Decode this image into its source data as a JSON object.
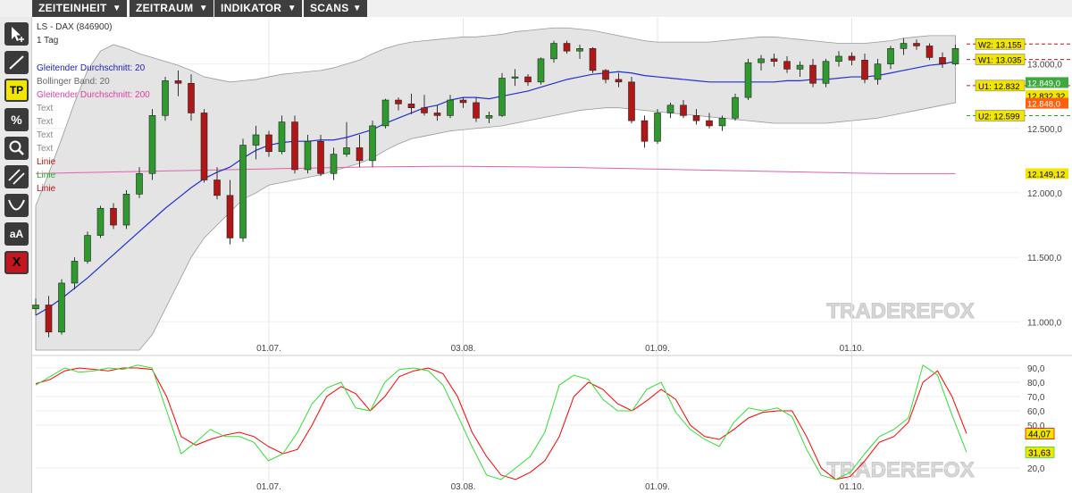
{
  "menus": [
    "ZEITEINHEIT",
    "ZEITRAUM",
    "INDIKATOR",
    "SCANS"
  ],
  "menu_arrow": "▼",
  "tools": [
    {
      "name": "cursor-icon"
    },
    {
      "name": "line-tool-icon"
    },
    {
      "name": "tp-button",
      "label": "TP"
    },
    {
      "name": "percent-icon",
      "label": "%"
    },
    {
      "name": "zoom-icon"
    },
    {
      "name": "parallel-lines-icon"
    },
    {
      "name": "curve-icon"
    },
    {
      "name": "text-size-icon",
      "label": "aA"
    },
    {
      "name": "close-button",
      "label": "X"
    }
  ],
  "legend": {
    "instrument": "LS - DAX (846900)",
    "timeframe": "1 Tag",
    "items": [
      {
        "text": "Gleitender Durchschnitt: 20",
        "color": "#2020c0"
      },
      {
        "text": "Bollinger Band: 20",
        "color": "#666666"
      },
      {
        "text": "Gleitender Durchschnitt: 200",
        "color": "#e040a0"
      },
      {
        "text": "Text",
        "color": "#888888"
      },
      {
        "text": "Text",
        "color": "#888888"
      },
      {
        "text": "Text",
        "color": "#888888"
      },
      {
        "text": "Text",
        "color": "#888888"
      },
      {
        "text": "Linie",
        "color": "#c81010"
      },
      {
        "text": "Linie",
        "color": "#20b020"
      },
      {
        "text": "Linie",
        "color": "#c81010"
      }
    ]
  },
  "watermark": "TRADEREFOX",
  "chart_data": [
    {
      "type": "candlestick",
      "title": "LS - DAX (846900)",
      "ylim": [
        10780,
        13330
      ],
      "y_ticks": [
        "13.000,0",
        "12.500,0",
        "12.000,0",
        "11.500,0",
        "11.000,0"
      ],
      "y_tick_values": [
        13000,
        12500,
        12000,
        11500,
        11000
      ],
      "x_tick_labels": [
        "01.07.",
        "03.08.",
        "01.09.",
        "01.10."
      ],
      "x_tick_index": [
        18,
        33,
        48,
        63
      ],
      "candles": [
        [
          11100,
          11180,
          11050,
          11130
        ],
        [
          11130,
          11200,
          10880,
          10920
        ],
        [
          10920,
          11330,
          10900,
          11300
        ],
        [
          11300,
          11500,
          11250,
          11470
        ],
        [
          11470,
          11700,
          11450,
          11670
        ],
        [
          11670,
          11900,
          11650,
          11880
        ],
        [
          11880,
          11920,
          11720,
          11750
        ],
        [
          11750,
          12020,
          11720,
          11990
        ],
        [
          11990,
          12200,
          11960,
          12150
        ],
        [
          12150,
          12650,
          12100,
          12600
        ],
        [
          12600,
          12900,
          12560,
          12870
        ],
        [
          12870,
          12950,
          12750,
          12850
        ],
        [
          12850,
          12920,
          12560,
          12620
        ],
        [
          12620,
          12650,
          12080,
          12100
        ],
        [
          12100,
          12200,
          11950,
          11980
        ],
        [
          11980,
          12100,
          11600,
          11650
        ],
        [
          11650,
          12420,
          11620,
          12370
        ],
        [
          12370,
          12520,
          12260,
          12450
        ],
        [
          12450,
          12480,
          12280,
          12320
        ],
        [
          12320,
          12600,
          12300,
          12550
        ],
        [
          12550,
          12600,
          12150,
          12180
        ],
        [
          12180,
          12450,
          12150,
          12400
        ],
        [
          12400,
          12450,
          12130,
          12150
        ],
        [
          12150,
          12350,
          12100,
          12300
        ],
        [
          12300,
          12550,
          12280,
          12350
        ],
        [
          12350,
          12450,
          12200,
          12250
        ],
        [
          12250,
          12560,
          12200,
          12520
        ],
        [
          12520,
          12730,
          12500,
          12720
        ],
        [
          12720,
          12740,
          12640,
          12690
        ],
        [
          12690,
          12770,
          12610,
          12660
        ],
        [
          12660,
          12760,
          12600,
          12620
        ],
        [
          12620,
          12680,
          12560,
          12600
        ],
        [
          12600,
          12760,
          12580,
          12720
        ],
        [
          12720,
          12740,
          12660,
          12700
        ],
        [
          12700,
          12740,
          12550,
          12580
        ],
        [
          12580,
          12630,
          12540,
          12600
        ],
        [
          12600,
          12930,
          12590,
          12890
        ],
        [
          12890,
          12960,
          12830,
          12900
        ],
        [
          12900,
          12920,
          12830,
          12860
        ],
        [
          12860,
          13050,
          12840,
          13040
        ],
        [
          13040,
          13180,
          13010,
          13160
        ],
        [
          13160,
          13180,
          13080,
          13100
        ],
        [
          13100,
          13150,
          13040,
          13120
        ],
        [
          13120,
          13130,
          12930,
          12950
        ],
        [
          12950,
          12960,
          12850,
          12880
        ],
        [
          12880,
          12930,
          12820,
          12860
        ],
        [
          12860,
          12900,
          12540,
          12560
        ],
        [
          12560,
          12600,
          12350,
          12400
        ],
        [
          12400,
          12650,
          12380,
          12620
        ],
        [
          12620,
          12700,
          12580,
          12680
        ],
        [
          12680,
          12720,
          12580,
          12600
        ],
        [
          12600,
          12650,
          12530,
          12560
        ],
        [
          12560,
          12620,
          12500,
          12520
        ],
        [
          12520,
          12600,
          12480,
          12580
        ],
        [
          12580,
          12770,
          12560,
          12740
        ],
        [
          12740,
          13040,
          12720,
          13010
        ],
        [
          13010,
          13070,
          12950,
          13040
        ],
        [
          13040,
          13080,
          12980,
          13020
        ],
        [
          13020,
          13060,
          12930,
          12960
        ],
        [
          12960,
          13020,
          12900,
          12990
        ],
        [
          12990,
          13040,
          12820,
          12850
        ],
        [
          12850,
          13040,
          12820,
          13020
        ],
        [
          13020,
          13100,
          12980,
          13060
        ],
        [
          13060,
          13090,
          12990,
          13030
        ],
        [
          13030,
          13080,
          12850,
          12880
        ],
        [
          12880,
          13040,
          12840,
          13000
        ],
        [
          13000,
          13140,
          12960,
          13120
        ],
        [
          13120,
          13200,
          13070,
          13160
        ],
        [
          13160,
          13190,
          13110,
          13140
        ],
        [
          13140,
          13160,
          13030,
          13050
        ],
        [
          13050,
          13090,
          12970,
          13000
        ],
        [
          13000,
          13150,
          12990,
          13120
        ]
      ]
    },
    {
      "type": "line",
      "ylim": [
        10,
        95
      ],
      "y_ticks": [
        "90,0",
        "80,0",
        "70,0",
        "60,0",
        "50,0",
        "20,0"
      ],
      "y_tick_values": [
        90,
        80,
        70,
        60,
        50,
        20
      ],
      "x_tick_labels": [
        "01.07.",
        "03.08.",
        "01.09.",
        "01.10."
      ],
      "series": [
        {
          "color": "#ff0000",
          "last_label": "44,07",
          "values": [
            79,
            82,
            88,
            90,
            89,
            88,
            90,
            90,
            89,
            70,
            42,
            36,
            40,
            43,
            45,
            42,
            35,
            30,
            33,
            50,
            70,
            77,
            72,
            60,
            70,
            84,
            88,
            90,
            86,
            70,
            45,
            28,
            15,
            12,
            17,
            25,
            42,
            70,
            80,
            75,
            65,
            60,
            67,
            75,
            68,
            50,
            42,
            40,
            47,
            55,
            59,
            60,
            60,
            42,
            20,
            12,
            14,
            25,
            38,
            42,
            52,
            80,
            88,
            70,
            44
          ]
        },
        {
          "color": "#33dd33",
          "last_label": "31,63",
          "values": [
            78,
            84,
            90,
            87,
            88,
            90,
            89,
            92,
            90,
            60,
            30,
            38,
            47,
            42,
            42,
            38,
            25,
            30,
            45,
            65,
            76,
            80,
            62,
            60,
            80,
            89,
            90,
            88,
            78,
            57,
            35,
            15,
            12,
            20,
            28,
            45,
            78,
            85,
            82,
            68,
            60,
            60,
            75,
            80,
            59,
            47,
            40,
            35,
            52,
            62,
            60,
            62,
            56,
            33,
            15,
            12,
            17,
            30,
            42,
            47,
            55,
            92,
            85,
            57,
            31
          ]
        }
      ]
    }
  ],
  "overlays": {
    "ma20": [
      11050,
      11110,
      11180,
      11260,
      11340,
      11430,
      11520,
      11610,
      11700,
      11790,
      11880,
      11960,
      12040,
      12110,
      12160,
      12200,
      12270,
      12330,
      12370,
      12390,
      12400,
      12400,
      12410,
      12410,
      12430,
      12460,
      12490,
      12540,
      12580,
      12620,
      12660,
      12680,
      12720,
      12740,
      12740,
      12730,
      12750,
      12770,
      12790,
      12820,
      12850,
      12880,
      12900,
      12920,
      12930,
      12940,
      12930,
      12910,
      12900,
      12890,
      12880,
      12870,
      12860,
      12860,
      12860,
      12860,
      12860,
      12860,
      12870,
      12870,
      12880,
      12880,
      12890,
      12900,
      12900,
      12910,
      12930,
      12950,
      12970,
      12990,
      13000,
      13020
    ],
    "bb_upper": [
      11900,
      12150,
      12420,
      12700,
      12950,
      13100,
      13150,
      13120,
      13080,
      13050,
      13020,
      12990,
      12950,
      12900,
      12880,
      12860,
      12870,
      12880,
      12900,
      12920,
      12930,
      12940,
      12950,
      12970,
      13000,
      13030,
      13080,
      13120,
      13150,
      13170,
      13180,
      13190,
      13200,
      13210,
      13210,
      13220,
      13230,
      13250,
      13260,
      13270,
      13280,
      13280,
      13270,
      13260,
      13240,
      13220,
      13200,
      13180,
      13170,
      13170,
      13170,
      13170,
      13170,
      13180,
      13190,
      13200,
      13210,
      13210,
      13200,
      13190,
      13180,
      13170,
      13160,
      13160,
      13160,
      13170,
      13180,
      13200,
      13210,
      13220,
      13220,
      13220
    ],
    "bb_lower": [
      10200,
      10100,
      10100,
      10150,
      10200,
      10300,
      10400,
      10550,
      10700,
      10900,
      11100,
      11300,
      11500,
      11650,
      11750,
      11850,
      11950,
      12000,
      12060,
      12080,
      12100,
      12120,
      12140,
      12170,
      12200,
      12230,
      12270,
      12330,
      12380,
      12420,
      12440,
      12460,
      12480,
      12490,
      12500,
      12510,
      12520,
      12540,
      12560,
      12580,
      12600,
      12620,
      12640,
      12650,
      12660,
      12660,
      12650,
      12640,
      12630,
      12620,
      12610,
      12600,
      12590,
      12580,
      12570,
      12560,
      12550,
      12540,
      12540,
      12540,
      12540,
      12540,
      12550,
      12560,
      12570,
      12580,
      12600,
      12620,
      12640,
      12660,
      12680,
      12700
    ],
    "ma200": [
      12150,
      12152,
      12154,
      12156,
      12158,
      12160,
      12162,
      12164,
      12166,
      12168,
      12170,
      12172,
      12174,
      12176,
      12178,
      12180,
      12182,
      12184,
      12186,
      12188,
      12190,
      12192,
      12194,
      12196,
      12198,
      12200,
      12201,
      12202,
      12203,
      12204,
      12205,
      12206,
      12206,
      12206,
      12205,
      12204,
      12203,
      12202,
      12201,
      12200,
      12199,
      12198,
      12196,
      12194,
      12192,
      12190,
      12188,
      12186,
      12184,
      12182,
      12180,
      12178,
      12176,
      12174,
      12172,
      12170,
      12168,
      12166,
      12164,
      12162,
      12160,
      12158,
      12156,
      12154,
      12152,
      12150,
      12149,
      12149,
      12149,
      12149,
      12149,
      12149
    ]
  },
  "levels": [
    {
      "label": "W2: 13.155",
      "value": 13155,
      "color": "#c81010"
    },
    {
      "label": "W1: 13.035",
      "value": 13035,
      "color": "#c81010"
    },
    {
      "label": "U1: 12.832",
      "value": 12832,
      "color": "#c81010"
    },
    {
      "label": "U2: 12.599",
      "value": 12599,
      "color": "#20b020"
    }
  ],
  "price_tags": [
    {
      "text": "12.849,0",
      "value": 12849,
      "bg": "#3fa83f",
      "fg": "#ffffff"
    },
    {
      "text": "12.832,32",
      "value": 12832,
      "bg": "#f2e600",
      "fg": "#000000"
    },
    {
      "text": "12.848,0",
      "value": 12848,
      "bg": "#ff6010",
      "fg": "#ffffff"
    },
    {
      "text": "12.149,12",
      "value": 12149,
      "bg": "#f2e600",
      "fg": "#000000"
    }
  ]
}
